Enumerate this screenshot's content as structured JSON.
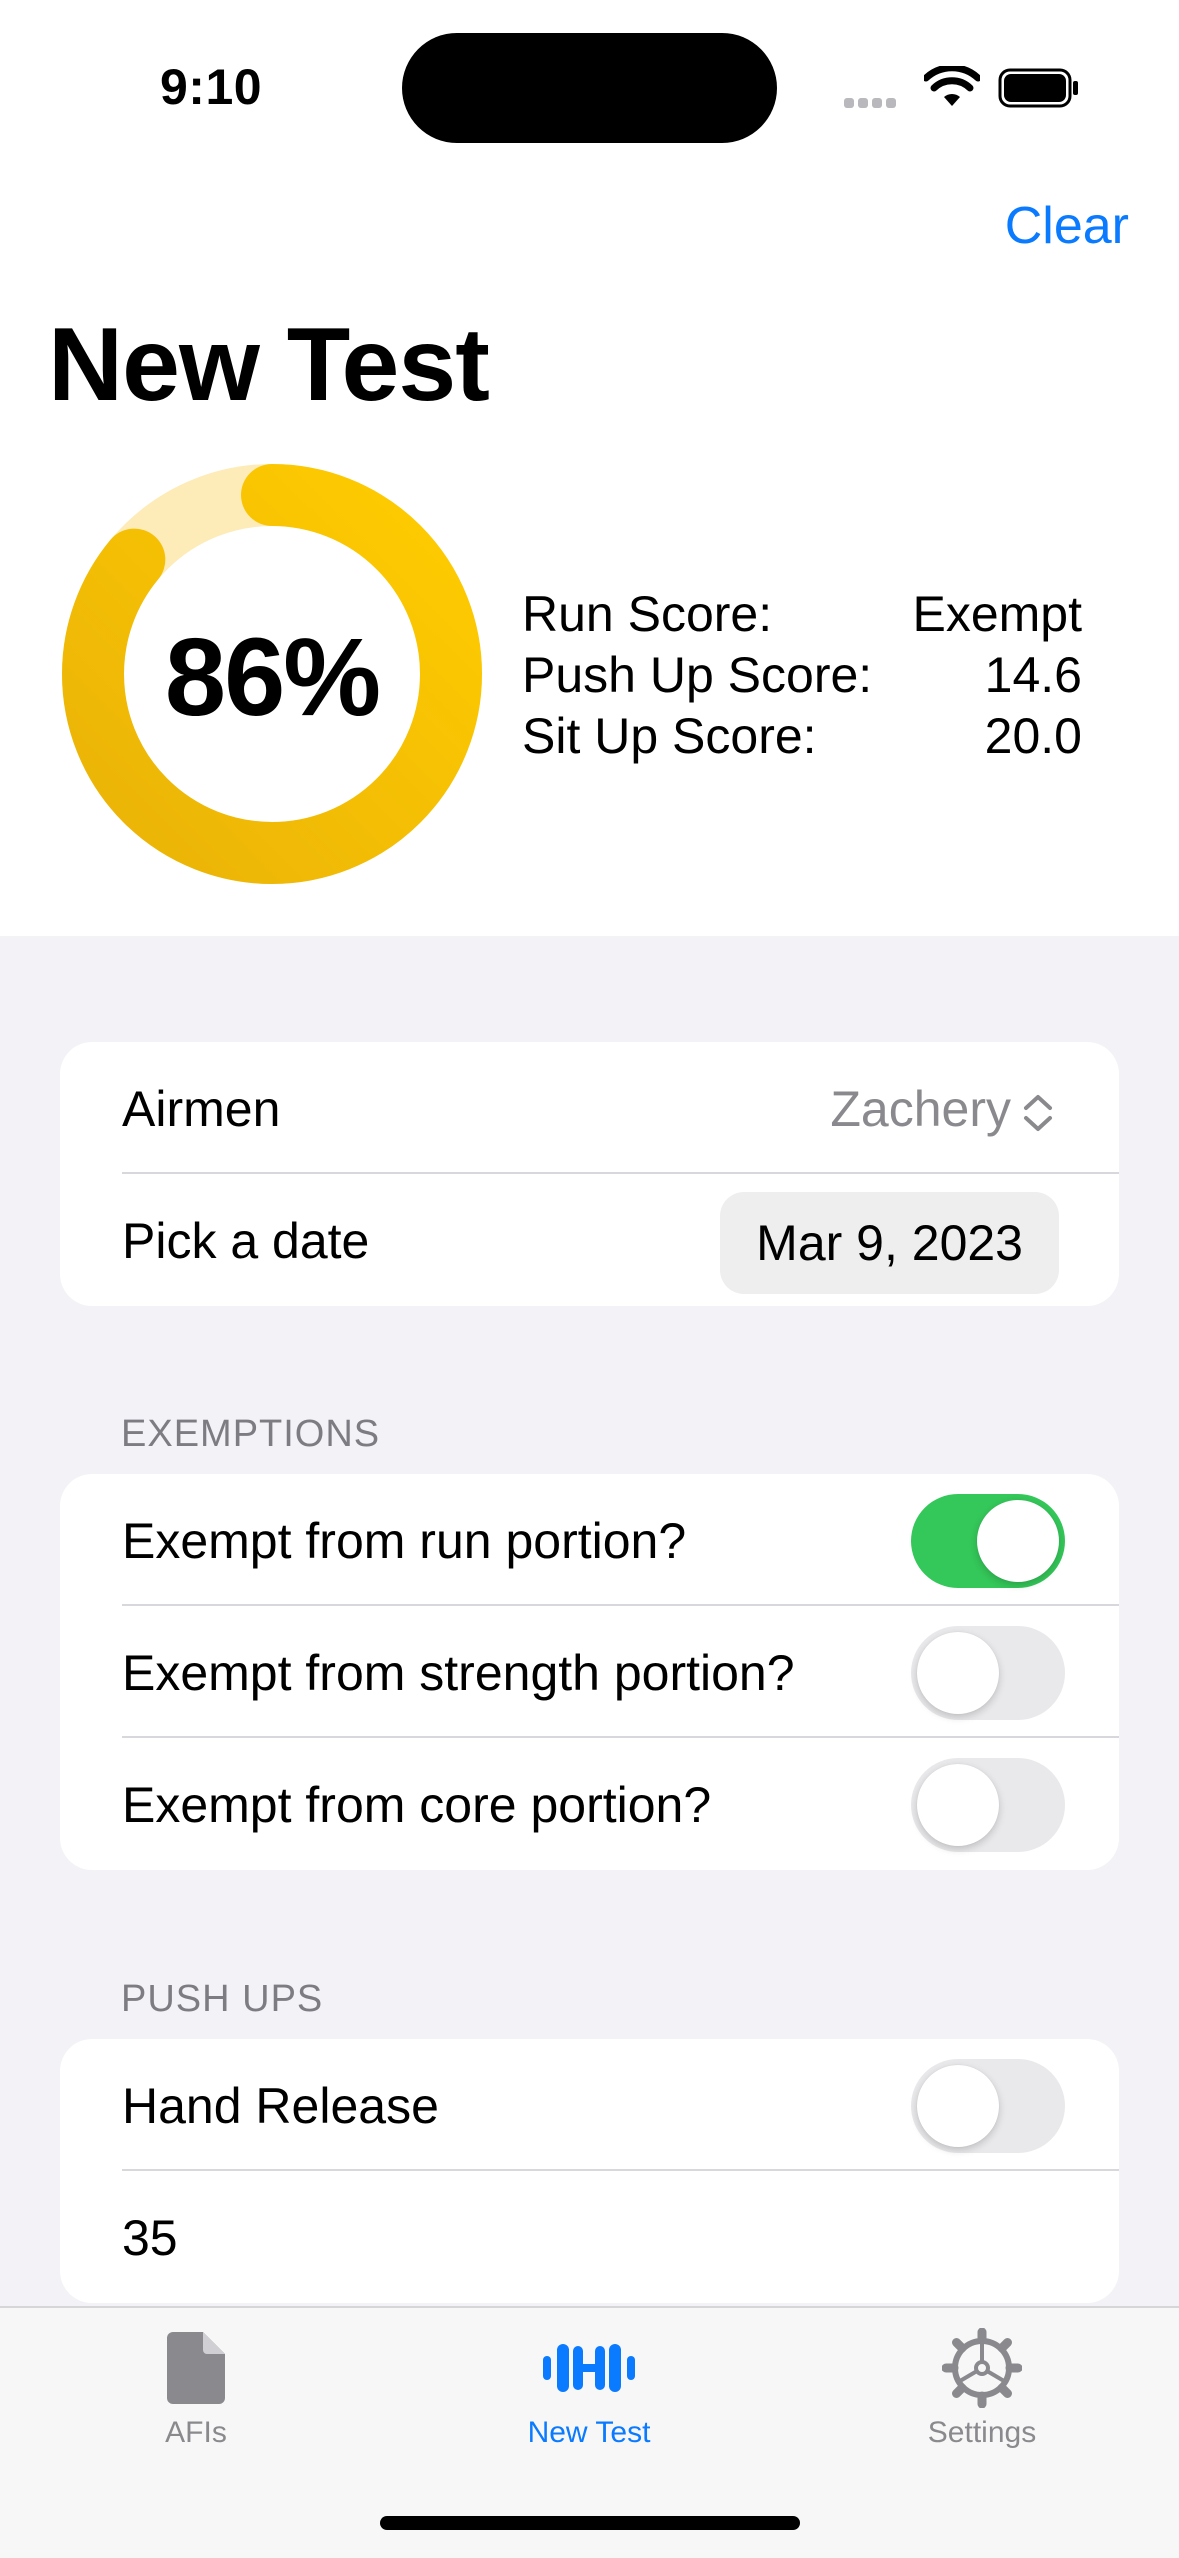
{
  "status_bar": {
    "time": "9:10"
  },
  "nav": {
    "clear_label": "Clear",
    "title": "New Test"
  },
  "summary": {
    "overall_percent_label": "86%",
    "overall_percent_value": 86,
    "ring_colors": {
      "track": "#fdebb8",
      "fill_start": "#ffcc00",
      "fill_end": "#eab308"
    },
    "scores": [
      {
        "label": "Run Score:",
        "value": "Exempt"
      },
      {
        "label": "Push Up Score:",
        "value": "14.6"
      },
      {
        "label": "Sit Up Score:",
        "value": "20.0"
      }
    ]
  },
  "info": {
    "airmen_label": "Airmen",
    "airmen_value": "Zachery",
    "date_label": "Pick a date",
    "date_value": "Mar 9, 2023"
  },
  "exemptions": {
    "header": "EXEMPTIONS",
    "items": [
      {
        "label": "Exempt from run portion?",
        "on": true
      },
      {
        "label": "Exempt from strength portion?",
        "on": false
      },
      {
        "label": "Exempt from core portion?",
        "on": false
      }
    ]
  },
  "push_ups": {
    "header": "PUSH UPS",
    "hand_release_label": "Hand Release",
    "hand_release_on": false,
    "count_value": "35"
  },
  "tab_bar": {
    "tabs": [
      {
        "label": "AFIs",
        "icon": "document-icon",
        "active": false
      },
      {
        "label": "New Test",
        "icon": "dumbbell-icon",
        "active": true
      },
      {
        "label": "Settings",
        "icon": "gear-icon",
        "active": false
      }
    ]
  },
  "colors": {
    "accent": "#0a7aff",
    "toggle_on": "#34c759"
  }
}
